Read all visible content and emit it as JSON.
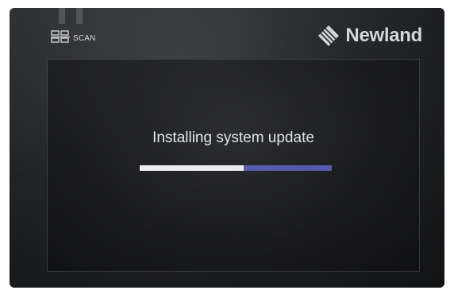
{
  "device": {
    "brand_name": "Newland",
    "brand_logo_icon": "newland-diamond-logo-icon",
    "scan_label": "SCAN",
    "scan_icon": "barcode-scan-icon"
  },
  "screen": {
    "title": "Installing system update",
    "progress": 0.54,
    "colors": {
      "progress_filled": "#f2f2f7",
      "progress_remaining": "#5b5fb6",
      "screen_bg": "#1b1c1f"
    }
  }
}
